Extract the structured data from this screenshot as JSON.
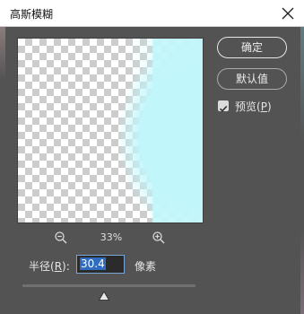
{
  "window": {
    "title": "高斯模糊"
  },
  "buttons": {
    "ok_label": "确定",
    "reset_label": "默认值"
  },
  "preview_option": {
    "label_prefix": "预览(",
    "label_hotkey": "P",
    "label_suffix": ")",
    "checked": true
  },
  "zoom": {
    "level": "33%",
    "zoom_out_icon": "zoom-out-icon",
    "zoom_in_icon": "zoom-in-icon"
  },
  "radius": {
    "label_prefix": "半径(",
    "label_hotkey": "R",
    "label_suffix": "):",
    "value": "30.4",
    "unit": "像素"
  },
  "slider": {
    "level": 0.47
  },
  "colors": {
    "dialog_bg": "#535353",
    "preview_blur": "#c1f6fb",
    "input_selection": "#2f6cc0"
  }
}
